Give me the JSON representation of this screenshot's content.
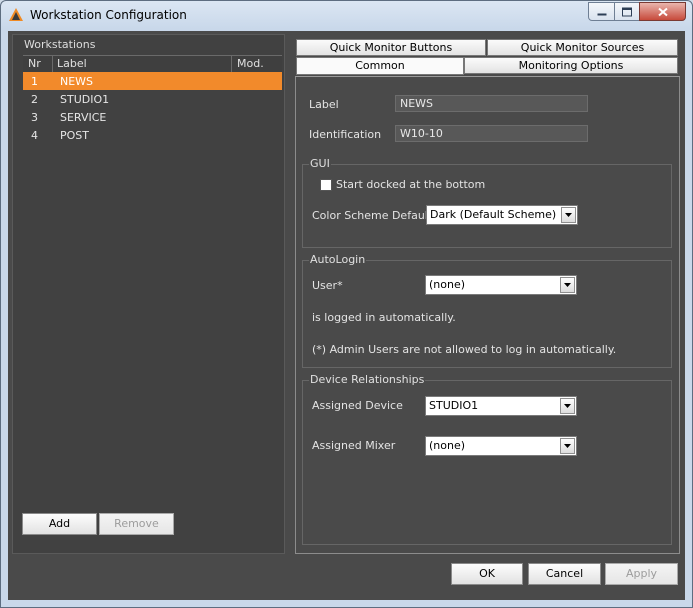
{
  "window": {
    "title": "Workstation Configuration"
  },
  "workstations": {
    "caption": "Workstations",
    "columns": [
      "Nr",
      "Label",
      "Mod."
    ],
    "rows": [
      {
        "nr": "1",
        "label": "NEWS",
        "selected": true
      },
      {
        "nr": "2",
        "label": "STUDIO1",
        "selected": false
      },
      {
        "nr": "3",
        "label": "SERVICE",
        "selected": false
      },
      {
        "nr": "4",
        "label": "POST",
        "selected": false
      }
    ],
    "add_label": "Add",
    "remove_label": "Remove"
  },
  "tabs": {
    "top_row": [
      "Quick Monitor Buttons",
      "Quick Monitor Sources"
    ],
    "bottom_row": [
      "Common",
      "Monitoring Options"
    ],
    "active": "Common"
  },
  "common": {
    "label_caption": "Label",
    "label_value": "NEWS",
    "identification_caption": "Identification",
    "identification_value": "W10-10",
    "gui": {
      "caption": "GUI",
      "start_docked_label": "Start docked at the bottom",
      "start_docked_checked": false,
      "color_scheme_caption": "Color Scheme Default:",
      "color_scheme_value": "Dark (Default Scheme)"
    },
    "autologin": {
      "caption": "AutoLogin",
      "user_caption": "User*",
      "user_value": "(none)",
      "note1": "is logged in automatically.",
      "note2": "(*) Admin Users are not allowed to log in automatically."
    },
    "device_relationships": {
      "caption": "Device Relationships",
      "assigned_device_caption": "Assigned Device",
      "assigned_device_value": "STUDIO1",
      "assigned_mixer_caption": "Assigned Mixer",
      "assigned_mixer_value": "(none)"
    }
  },
  "footer": {
    "ok_label": "OK",
    "cancel_label": "Cancel",
    "apply_label": "Apply"
  },
  "colors": {
    "selection": "#f28a2b",
    "panel": "#4a4a4a",
    "list": "#414141"
  },
  "icons": {
    "app": "app-logo-icon",
    "minimize": "minimize-icon",
    "maximize": "maximize-icon",
    "close": "close-icon",
    "dropdown": "chevron-down-icon"
  }
}
